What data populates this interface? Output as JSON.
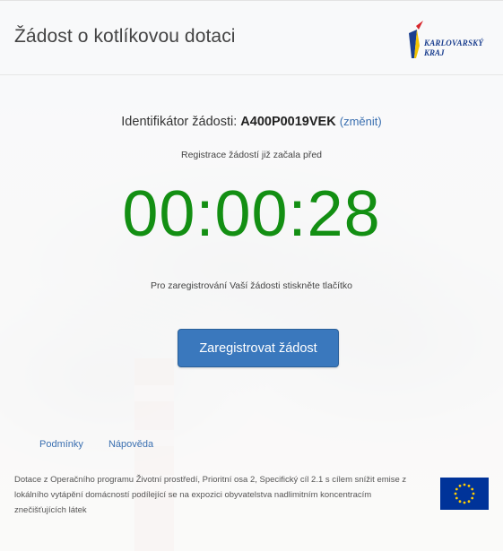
{
  "header": {
    "title": "Žádost o kotlíkovou dotaci",
    "logo": {
      "line1": "KARLOVARSKÝ",
      "line2": "KRAJ"
    }
  },
  "main": {
    "id_label": "Identifikátor žádosti:",
    "id_value": "A400P0019VEK",
    "change_link_label": "změnit",
    "registration_started": "Registrace žádostí již začala před",
    "timer": "00:00:28",
    "hint": "Pro zaregistrování Vaší žádosti stiskněte tlačítko",
    "register_button_label": "Zaregistrovat žádost"
  },
  "footer": {
    "links": [
      "Podmínky",
      "Nápověda"
    ],
    "text": "Dotace z Operačního programu Životní prostředí, Prioritní osa 2, Specifický cíl 2.1 s cílem snížit emise z lokálního vytápění domácností podílející se na expozici obyvatelstva nadlimitním koncentracím znečišťujících látek"
  },
  "colors": {
    "timer": "#138f13",
    "button": "#3a78bd",
    "link": "#3a6fb0",
    "eu_flag_blue": "#003399",
    "eu_flag_stars": "#ffcc00"
  }
}
